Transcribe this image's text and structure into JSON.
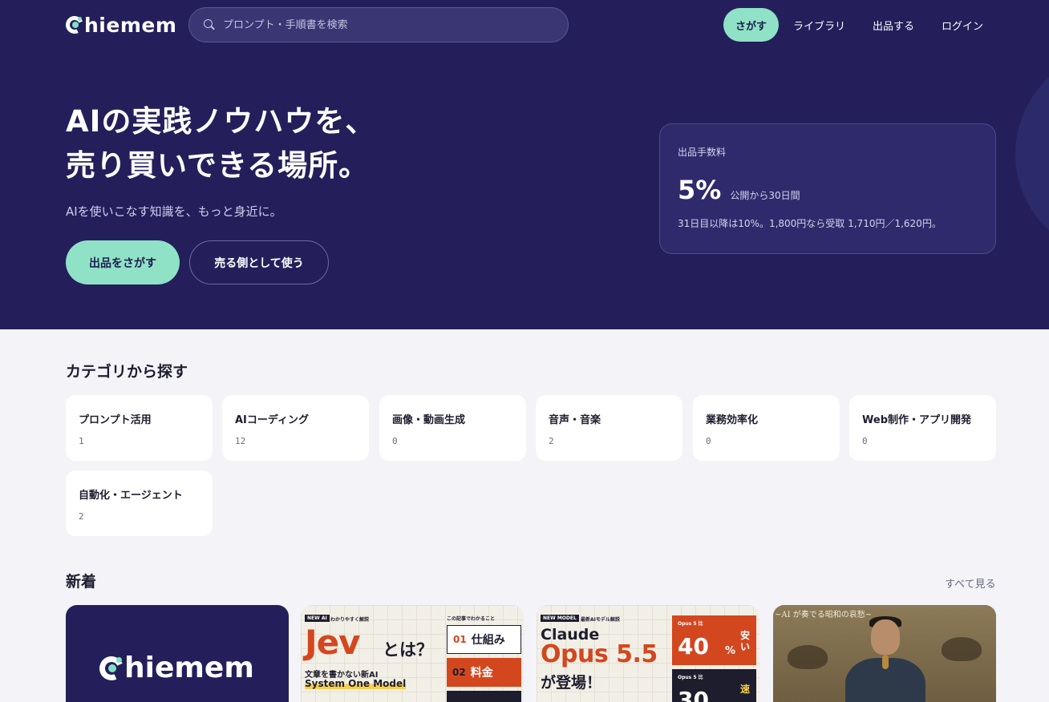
{
  "brand": {
    "name": "hiemem",
    "accent": "#8fe2c6",
    "hero_bg": "#241f5b"
  },
  "search": {
    "placeholder": "プロンプト・手順書を検索"
  },
  "nav": {
    "primary": "さがす",
    "library": "ライブラリ",
    "sell": "出品する",
    "login": "ログイン"
  },
  "hero": {
    "title_line1": "AIの実践ノウハウを、",
    "title_line2": "売り買いできる場所。",
    "subtitle": "AIを使いこなす知識を、もっと身近に。",
    "cta_find": "出品をさがす",
    "cta_sell": "売る側として使う"
  },
  "fee": {
    "label": "出品手数料",
    "value": "5%",
    "period": "公開から30日間",
    "note": "31日目以降は10%。1,800円なら受取 1,710円／1,620円。"
  },
  "categories": {
    "title": "カテゴリから探す",
    "items": [
      {
        "name": "プロンプト活用",
        "count": "1"
      },
      {
        "name": "AIコーディング",
        "count": "12"
      },
      {
        "name": "画像・動画生成",
        "count": "0"
      },
      {
        "name": "音声・音楽",
        "count": "2"
      },
      {
        "name": "業務効率化",
        "count": "0"
      },
      {
        "name": "Web制作・アプリ開発",
        "count": "0"
      },
      {
        "name": "自動化・エージェント",
        "count": "2"
      }
    ]
  },
  "new_section": {
    "title": "新着",
    "see_all": "すべて見る",
    "cards": [
      {
        "logo": "hiemem"
      },
      {
        "tag": "NEW AI",
        "tag_sub": "わかりやすく解説",
        "headline": "Jev",
        "headline_tail": "とは？",
        "line1": "文章を書かない新AI",
        "line2": "System One Model",
        "box_label": "この記事でわかること",
        "box1_num": "01",
        "box1_text": "仕組み",
        "box2_num": "02",
        "box2_text": "料金"
      },
      {
        "tag": "NEW MODEL",
        "tag_sub": "最新AIモデル解説",
        "line1": "Claude",
        "line2": "Opus 5.5",
        "line3": "が登場！",
        "box1_small": "Opus 5 比",
        "box1_big": "40",
        "box1_unit": "%",
        "box1_vert": "安い",
        "box2_small": "Opus 5 比",
        "box2_big": "30",
        "box2_vert": "速"
      },
      {
        "caption": "~AI が奏でる昭和の哀愁~"
      }
    ]
  }
}
